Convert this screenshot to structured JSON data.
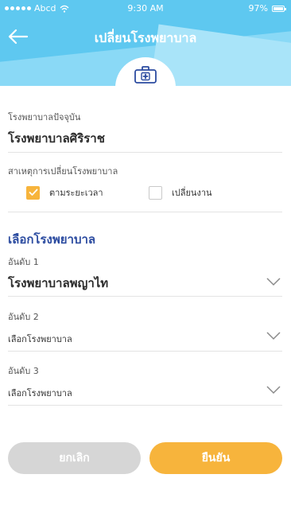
{
  "statusbar": {
    "carrier": "Abcd",
    "time": "9:30 AM",
    "battery": "97%"
  },
  "nav": {
    "title": "เปลี่ยนโรงพยาบาล"
  },
  "current_hospital": {
    "label": "โรงพยาบาลปัจจุบัน",
    "value": "โรงพยาบาลศิริราช"
  },
  "reason": {
    "label": "สาเหตุการเปลี่ยนโรงพยาบาล",
    "options": [
      {
        "label": "ตามระยะเวลา",
        "checked": true
      },
      {
        "label": "เปลี่ยนงาน",
        "checked": false
      }
    ]
  },
  "select_hospital": {
    "heading": "เลือกโรงพยาบาล",
    "ranks": [
      {
        "label": "อันดับ 1",
        "value": "โรงพยาบาลพญาไท"
      },
      {
        "label": "อันดับ 2",
        "value": "เลือกโรงพยาบาล"
      },
      {
        "label": "อันดับ 3",
        "value": "เลือกโรงพยาบาล"
      }
    ]
  },
  "buttons": {
    "cancel": "ยกเลิก",
    "confirm": "ยืนยัน"
  },
  "colors": {
    "header": "#5ec8f0",
    "accent": "#f7b43c",
    "heading": "#2b4ba0",
    "cancel": "#d6d6d6"
  },
  "icons": {
    "back": "arrow-left-icon",
    "badge": "medical-kit-icon",
    "dropdown": "chevron-down-icon",
    "check": "check-icon"
  }
}
